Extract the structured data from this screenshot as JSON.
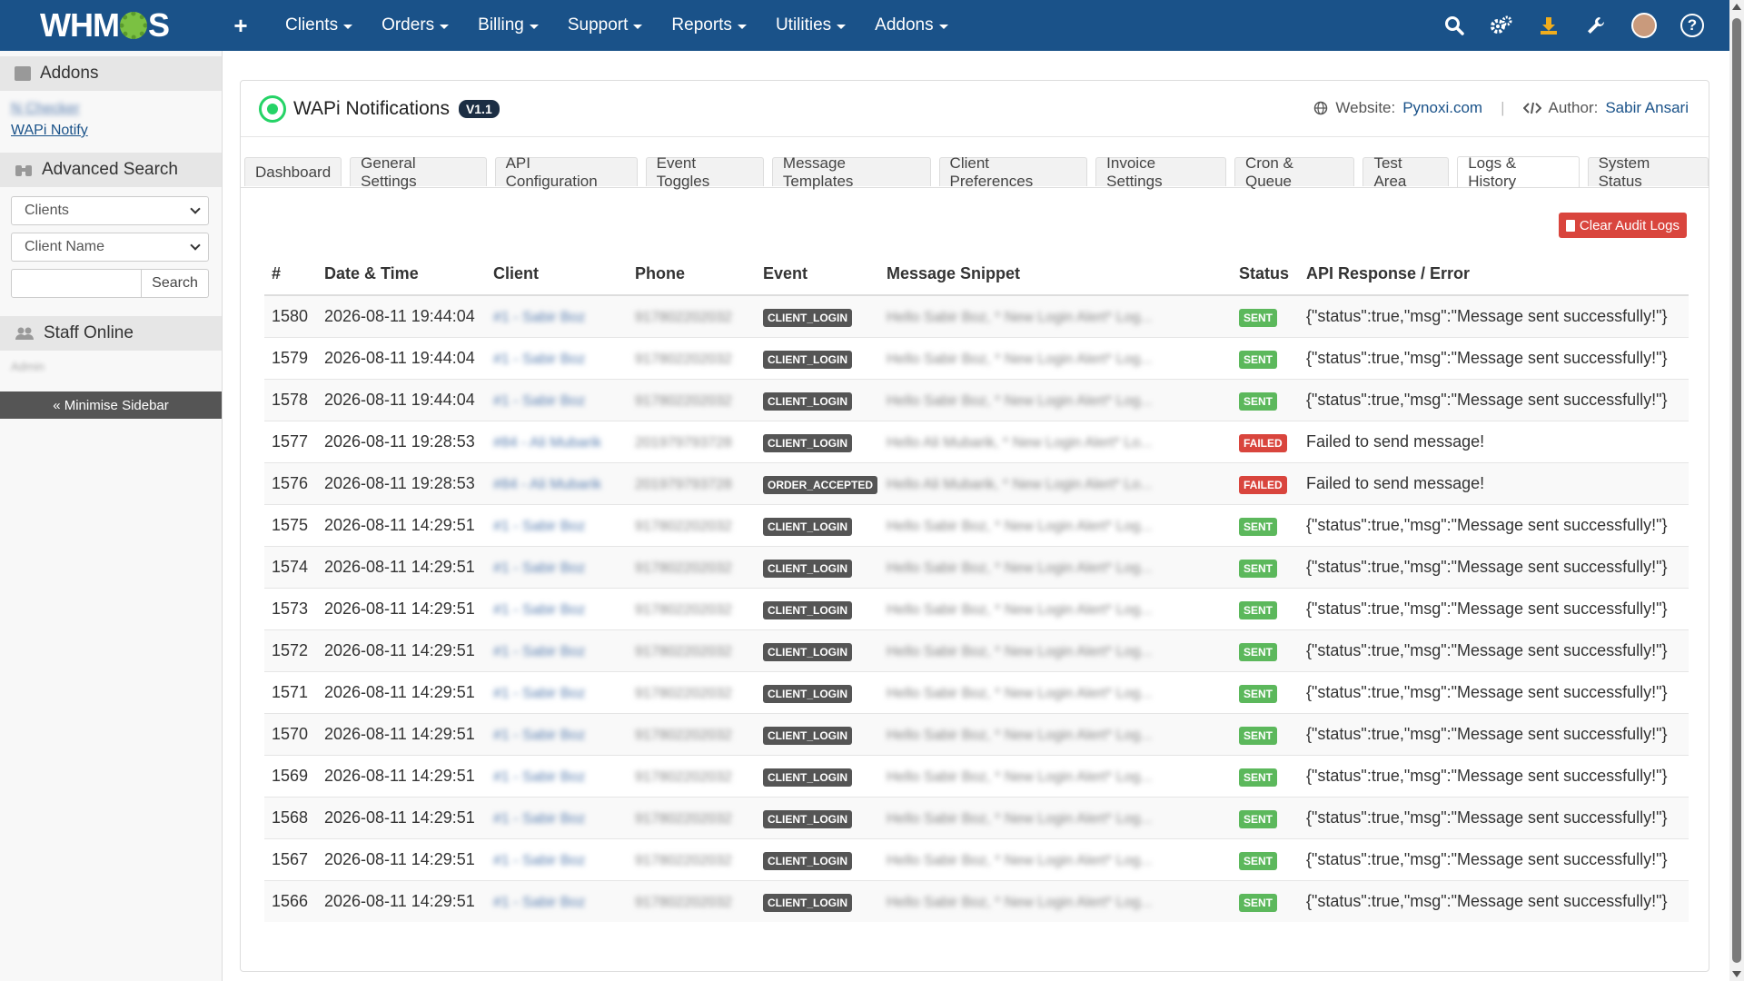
{
  "topbar": {
    "logo": "WHMCS",
    "nav": [
      "Clients",
      "Orders",
      "Billing",
      "Support",
      "Reports",
      "Utilities",
      "Addons"
    ]
  },
  "sidebar": {
    "addons_title": "Addons",
    "links": [
      "N Checker",
      "WAPi Notify"
    ],
    "advanced_search_title": "Advanced Search",
    "select1": "Clients",
    "select2": "Client Name",
    "search_button": "Search",
    "staff_title": "Staff Online",
    "staff_name": "Admin",
    "minimise": "« Minimise Sidebar"
  },
  "header": {
    "title": "WAPi Notifications",
    "version": "V1.1",
    "website_label": "Website:",
    "website": "Pynoxi.com",
    "author_label": "Author:",
    "author": "Sabir Ansari"
  },
  "tabs": [
    "Dashboard",
    "General Settings",
    "API Configuration",
    "Event Toggles",
    "Message Templates",
    "Client Preferences",
    "Invoice Settings",
    "Cron & Queue",
    "Test Area",
    "Logs & History",
    "System Status"
  ],
  "active_tab": "Logs & History",
  "clear_button": "Clear Audit Logs",
  "columns": [
    "#",
    "Date & Time",
    "Client",
    "Phone",
    "Event",
    "Message Snippet",
    "Status",
    "API Response / Error"
  ],
  "rows": [
    {
      "id": "1580",
      "date": "2026-08-11 19:44:04",
      "client": "#1 - Sabir Boz",
      "phone": "917802202032",
      "event": "CLIENT_LOGIN",
      "msg": "Hello Sabir Boz, * New Login Alert* Log...",
      "status": "SENT",
      "response": "{\"status\":true,\"msg\":\"Message sent successfully!\"}"
    },
    {
      "id": "1579",
      "date": "2026-08-11 19:44:04",
      "client": "#1 - Sabir Boz",
      "phone": "917802202032",
      "event": "CLIENT_LOGIN",
      "msg": "Hello Sabir Boz, * New Login Alert* Log...",
      "status": "SENT",
      "response": "{\"status\":true,\"msg\":\"Message sent successfully!\"}"
    },
    {
      "id": "1578",
      "date": "2026-08-11 19:44:04",
      "client": "#1 - Sabir Boz",
      "phone": "917802202032",
      "event": "CLIENT_LOGIN",
      "msg": "Hello Sabir Boz, * New Login Alert* Log...",
      "status": "SENT",
      "response": "{\"status\":true,\"msg\":\"Message sent successfully!\"}"
    },
    {
      "id": "1577",
      "date": "2026-08-11 19:28:53",
      "client": "#84 - Ali Mubarik",
      "phone": "201979793728",
      "event": "CLIENT_LOGIN",
      "msg": "Hello Ali Mubarik, * New Login Alert* Lo...",
      "status": "FAILED",
      "response": "Failed to send message!"
    },
    {
      "id": "1576",
      "date": "2026-08-11 19:28:53",
      "client": "#84 - Ali Mubarik",
      "phone": "201979793728",
      "event": "ORDER_ACCEPTED",
      "msg": "Hello Ali Mubarik, * New Login Alert* Lo...",
      "status": "FAILED",
      "response": "Failed to send message!"
    },
    {
      "id": "1575",
      "date": "2026-08-11 14:29:51",
      "client": "#1 - Sabir Boz",
      "phone": "917802202032",
      "event": "CLIENT_LOGIN",
      "msg": "Hello Sabir Boz, * New Login Alert* Log...",
      "status": "SENT",
      "response": "{\"status\":true,\"msg\":\"Message sent successfully!\"}"
    },
    {
      "id": "1574",
      "date": "2026-08-11 14:29:51",
      "client": "#1 - Sabir Boz",
      "phone": "917802202032",
      "event": "CLIENT_LOGIN",
      "msg": "Hello Sabir Boz, * New Login Alert* Log...",
      "status": "SENT",
      "response": "{\"status\":true,\"msg\":\"Message sent successfully!\"}"
    },
    {
      "id": "1573",
      "date": "2026-08-11 14:29:51",
      "client": "#1 - Sabir Boz",
      "phone": "917802202032",
      "event": "CLIENT_LOGIN",
      "msg": "Hello Sabir Boz, * New Login Alert* Log...",
      "status": "SENT",
      "response": "{\"status\":true,\"msg\":\"Message sent successfully!\"}"
    },
    {
      "id": "1572",
      "date": "2026-08-11 14:29:51",
      "client": "#1 - Sabir Boz",
      "phone": "917802202032",
      "event": "CLIENT_LOGIN",
      "msg": "Hello Sabir Boz, * New Login Alert* Log...",
      "status": "SENT",
      "response": "{\"status\":true,\"msg\":\"Message sent successfully!\"}"
    },
    {
      "id": "1571",
      "date": "2026-08-11 14:29:51",
      "client": "#1 - Sabir Boz",
      "phone": "917802202032",
      "event": "CLIENT_LOGIN",
      "msg": "Hello Sabir Boz, * New Login Alert* Log...",
      "status": "SENT",
      "response": "{\"status\":true,\"msg\":\"Message sent successfully!\"}"
    },
    {
      "id": "1570",
      "date": "2026-08-11 14:29:51",
      "client": "#1 - Sabir Boz",
      "phone": "917802202032",
      "event": "CLIENT_LOGIN",
      "msg": "Hello Sabir Boz, * New Login Alert* Log...",
      "status": "SENT",
      "response": "{\"status\":true,\"msg\":\"Message sent successfully!\"}"
    },
    {
      "id": "1569",
      "date": "2026-08-11 14:29:51",
      "client": "#1 - Sabir Boz",
      "phone": "917802202032",
      "event": "CLIENT_LOGIN",
      "msg": "Hello Sabir Boz, * New Login Alert* Log...",
      "status": "SENT",
      "response": "{\"status\":true,\"msg\":\"Message sent successfully!\"}"
    },
    {
      "id": "1568",
      "date": "2026-08-11 14:29:51",
      "client": "#1 - Sabir Boz",
      "phone": "917802202032",
      "event": "CLIENT_LOGIN",
      "msg": "Hello Sabir Boz, * New Login Alert* Log...",
      "status": "SENT",
      "response": "{\"status\":true,\"msg\":\"Message sent successfully!\"}"
    },
    {
      "id": "1567",
      "date": "2026-08-11 14:29:51",
      "client": "#1 - Sabir Boz",
      "phone": "917802202032",
      "event": "CLIENT_LOGIN",
      "msg": "Hello Sabir Boz, * New Login Alert* Log...",
      "status": "SENT",
      "response": "{\"status\":true,\"msg\":\"Message sent successfully!\"}"
    },
    {
      "id": "1566",
      "date": "2026-08-11 14:29:51",
      "client": "#1 - Sabir Boz",
      "phone": "917802202032",
      "event": "CLIENT_LOGIN",
      "msg": "Hello Sabir Boz, * New Login Alert* Log...",
      "status": "SENT",
      "response": "{\"status\":true,\"msg\":\"Message sent successfully!\"}"
    }
  ],
  "colors": {
    "topbar": "#1a5289",
    "sent": "#5cb85c",
    "failed": "#d9453d",
    "event_badge": "#555555",
    "version_badge": "#1c2e44"
  }
}
